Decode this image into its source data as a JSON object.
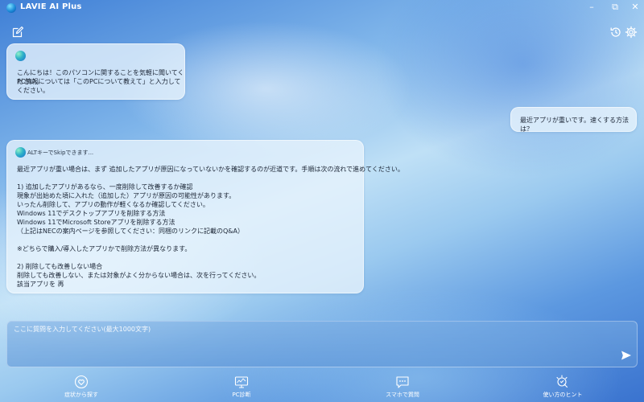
{
  "window": {
    "title": "LAVIE AI Plus",
    "controls": {
      "minimize": "–",
      "maximize": "⧉",
      "close": "✕"
    }
  },
  "toolbar": {
    "new_chat_icon": "edit-icon",
    "history_icon": "history-icon",
    "settings_icon": "gear-icon"
  },
  "chat": {
    "welcome": {
      "line1": "こんにちは！このパソコンに関することを気軽に聞いてください。",
      "line2": "PC情報については「このPCについて教えて」と入力してください。"
    },
    "user_message": "最近アプリが重いです。速くする方法は？",
    "response": {
      "skip_hint": "ALTキーでSkipできます...",
      "lines": [
        "最近アプリが重い場合は、まず 追加したアプリが原因になっていないかを確認するのが近道です。手順は次の流れで進めてください。",
        "1) 追加したアプリがあるなら、一度削除して改善するか確認",
        "現象が出始めた頃に入れた（追加した）アプリが原因の可能性があります。",
        "いったん削除して、アプリの動作が軽くなるか確認してください。",
        "Windows 11でデスクトップアプリを削除する方法",
        "Windows 11でMicrosoft Storeアプリを削除する方法",
        "（上記はNECの案内ページを参照してください：同梱のリンクに記載のQ&A）",
        "※どちらで購入/導入したアプリかで削除方法が異なります。",
        "2) 削除しても改善しない場合",
        "削除しても改善しない、または対象がよく分からない場合は、次を行ってください。",
        "該当アプリを 再"
      ]
    }
  },
  "input": {
    "placeholder": "ここに質問を入力してください(最大1000文字)",
    "value": ""
  },
  "nav": [
    {
      "label": "症状から探す",
      "icon": "heart-search-icon"
    },
    {
      "label": "PC診断",
      "icon": "monitor-icon"
    },
    {
      "label": "スマホで質問",
      "icon": "chat-bubble-icon"
    },
    {
      "label": "使い方のヒント",
      "icon": "hint-icon"
    }
  ]
}
